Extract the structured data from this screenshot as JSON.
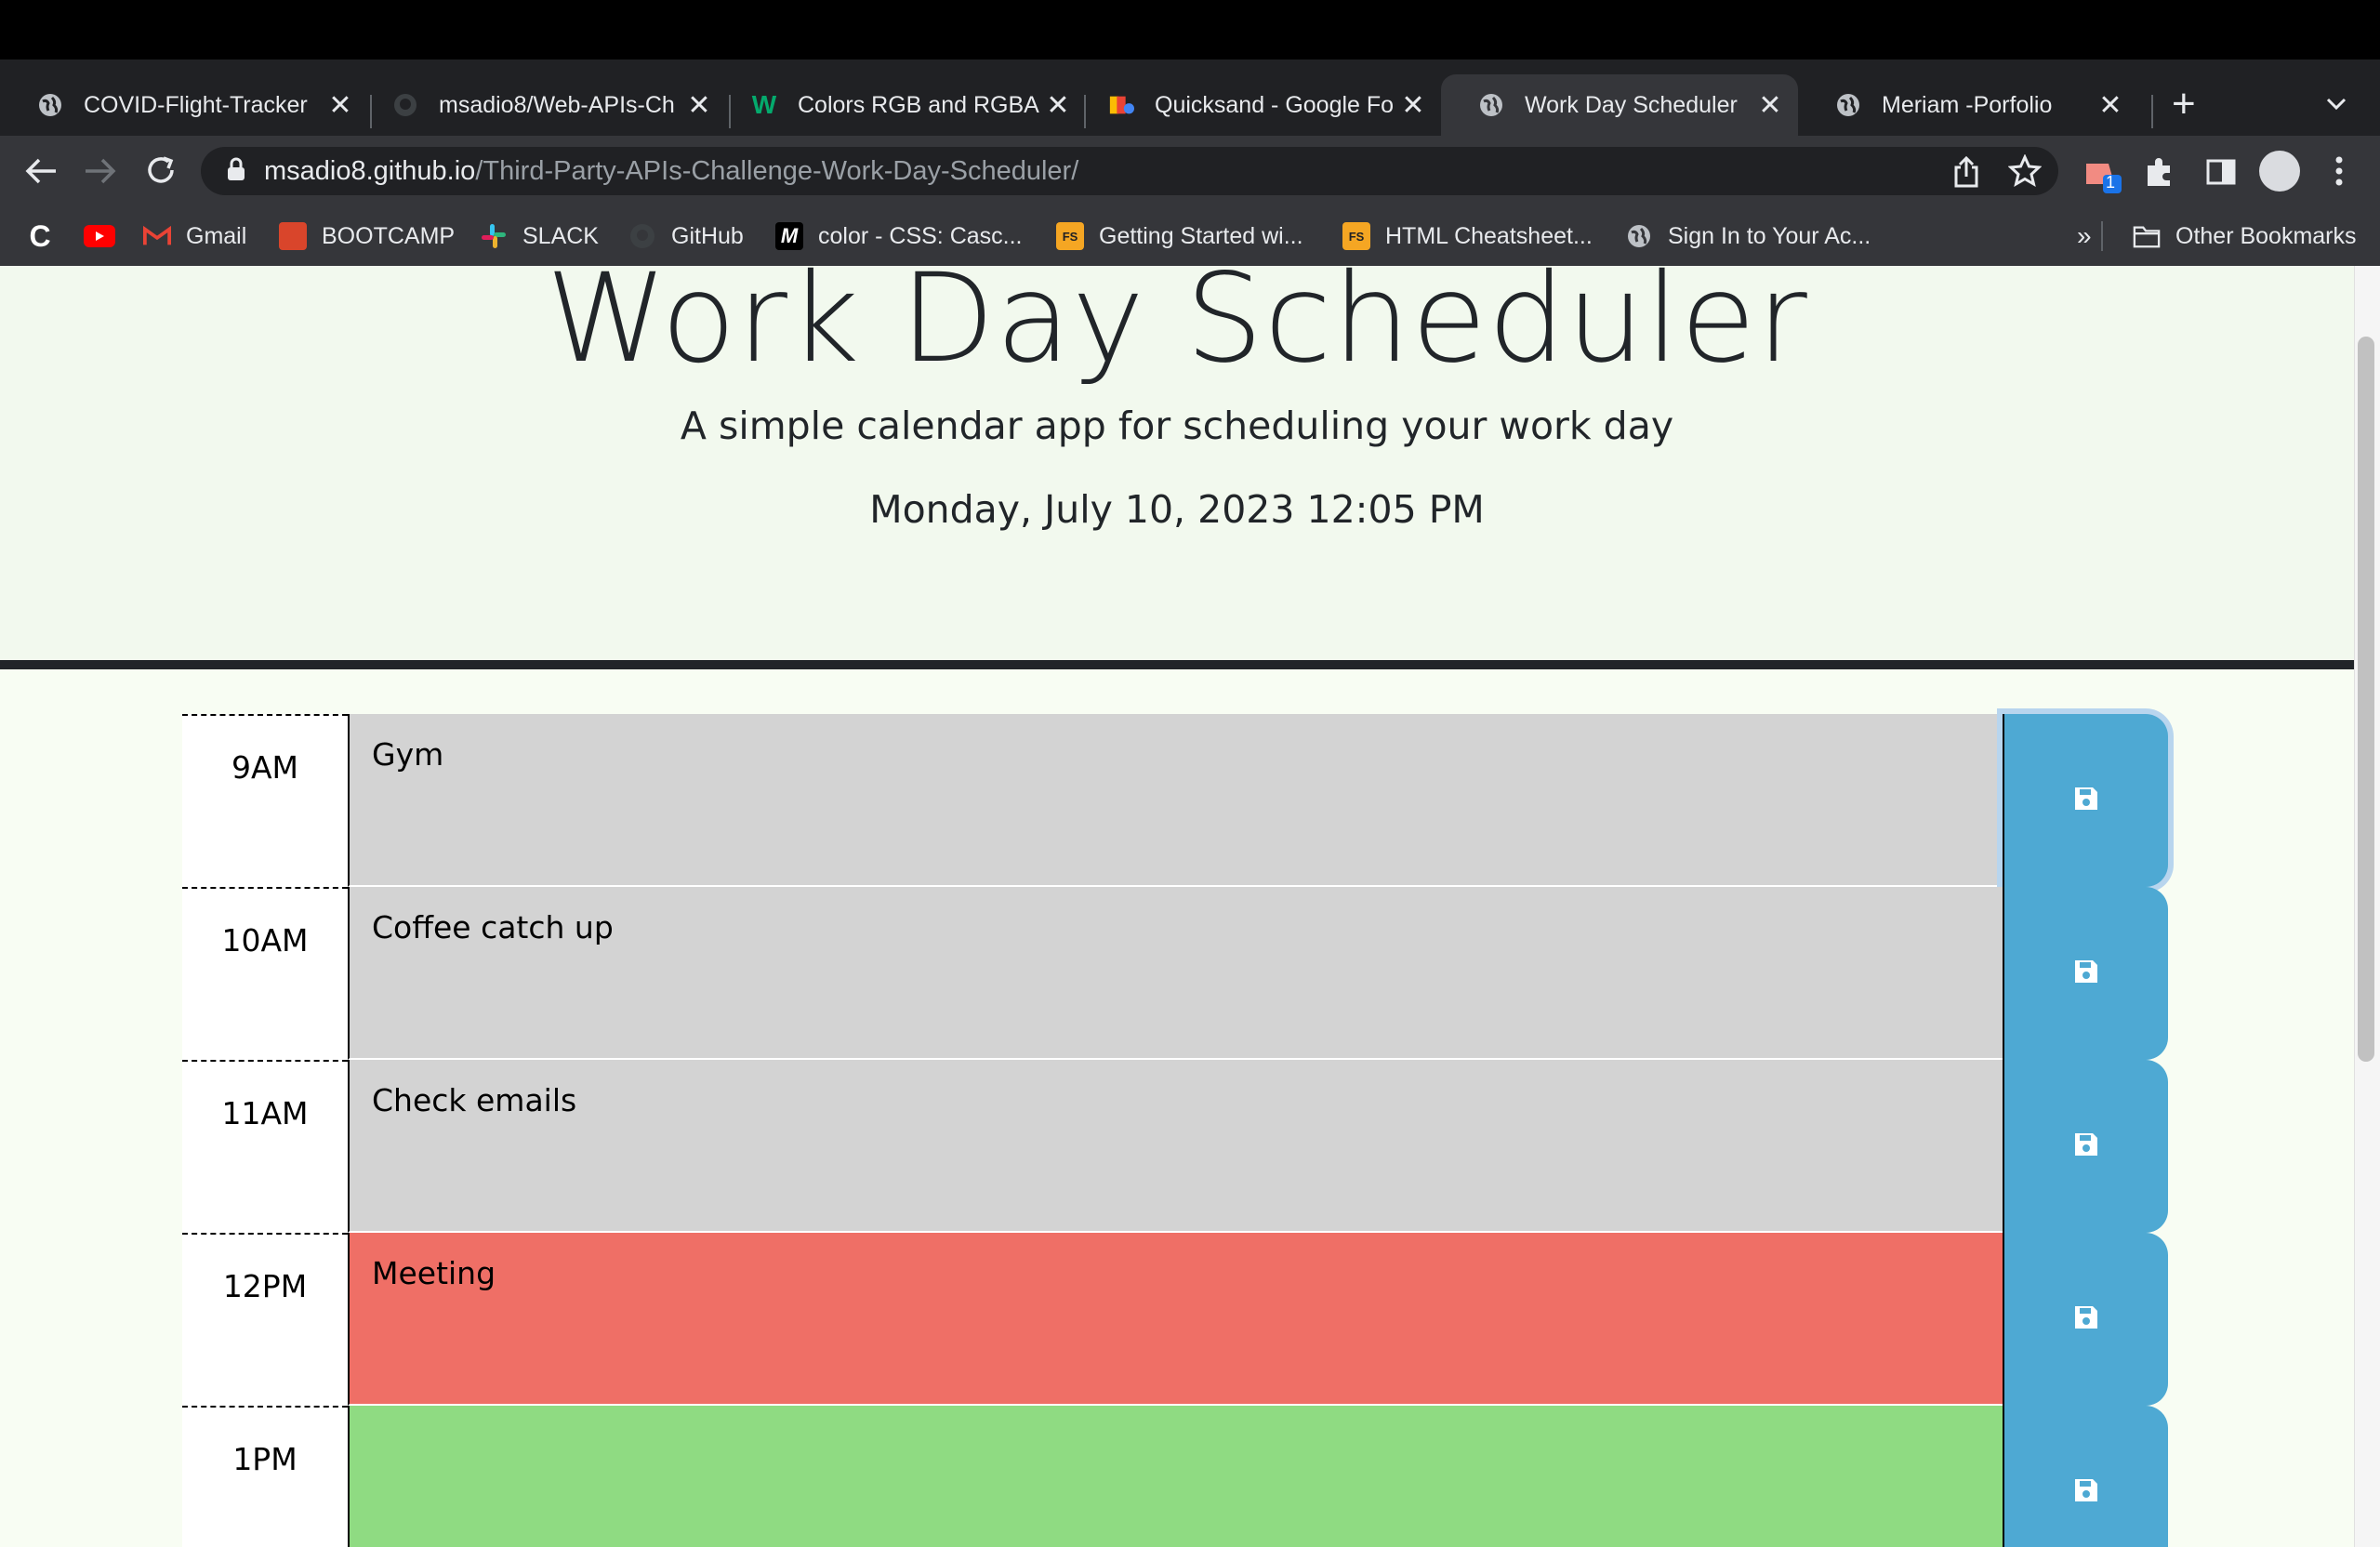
{
  "browser": {
    "tabs": [
      {
        "label": "COVID-Flight-Tracker",
        "icon": "globe-icon"
      },
      {
        "label": "msadio8/Web-APIs-Ch",
        "icon": "github-icon"
      },
      {
        "label": "Colors RGB and RGBA",
        "icon": "w3schools-icon"
      },
      {
        "label": "Quicksand - Google Fo",
        "icon": "google-fonts-icon"
      },
      {
        "label": "Work Day Scheduler",
        "icon": "globe-icon",
        "active": true
      },
      {
        "label": "Meriam -Porfolio",
        "icon": "globe-icon"
      }
    ],
    "url_host": "msadio8.github.io",
    "url_path": "/Third-Party-APIs-Challenge-Work-Day-Scheduler/",
    "extension_badge": "1",
    "bookmarks": [
      {
        "label": "Gmail"
      },
      {
        "label": "BOOTCAMP"
      },
      {
        "label": "SLACK"
      },
      {
        "label": "GitHub"
      },
      {
        "label": "color - CSS: Casc..."
      },
      {
        "label": "Getting Started wi..."
      },
      {
        "label": "HTML Cheatsheet..."
      },
      {
        "label": "Sign In to Your Ac..."
      }
    ],
    "bookmark_overflow": "»",
    "other_bookmarks": "Other Bookmarks",
    "colors": {
      "tabstrip": "#202124",
      "toolbar": "#35363a"
    }
  },
  "header": {
    "title": "Work Day Scheduler",
    "subtitle": "A simple calendar app for scheduling your work day",
    "current_day": "Monday, July 10, 2023 12:05 PM"
  },
  "schedule": [
    {
      "hour": "9AM",
      "text": "Gym",
      "status": "past"
    },
    {
      "hour": "10AM",
      "text": "Coffee catch up",
      "status": "past"
    },
    {
      "hour": "11AM",
      "text": "Check emails",
      "status": "past"
    },
    {
      "hour": "12PM",
      "text": "Meeting",
      "status": "present"
    },
    {
      "hour": "1PM",
      "text": "",
      "status": "future"
    }
  ],
  "colors": {
    "past": "#d3d3d3",
    "present": "#ef6f66",
    "future": "#8fdb82",
    "save": "#4ea9d3"
  }
}
